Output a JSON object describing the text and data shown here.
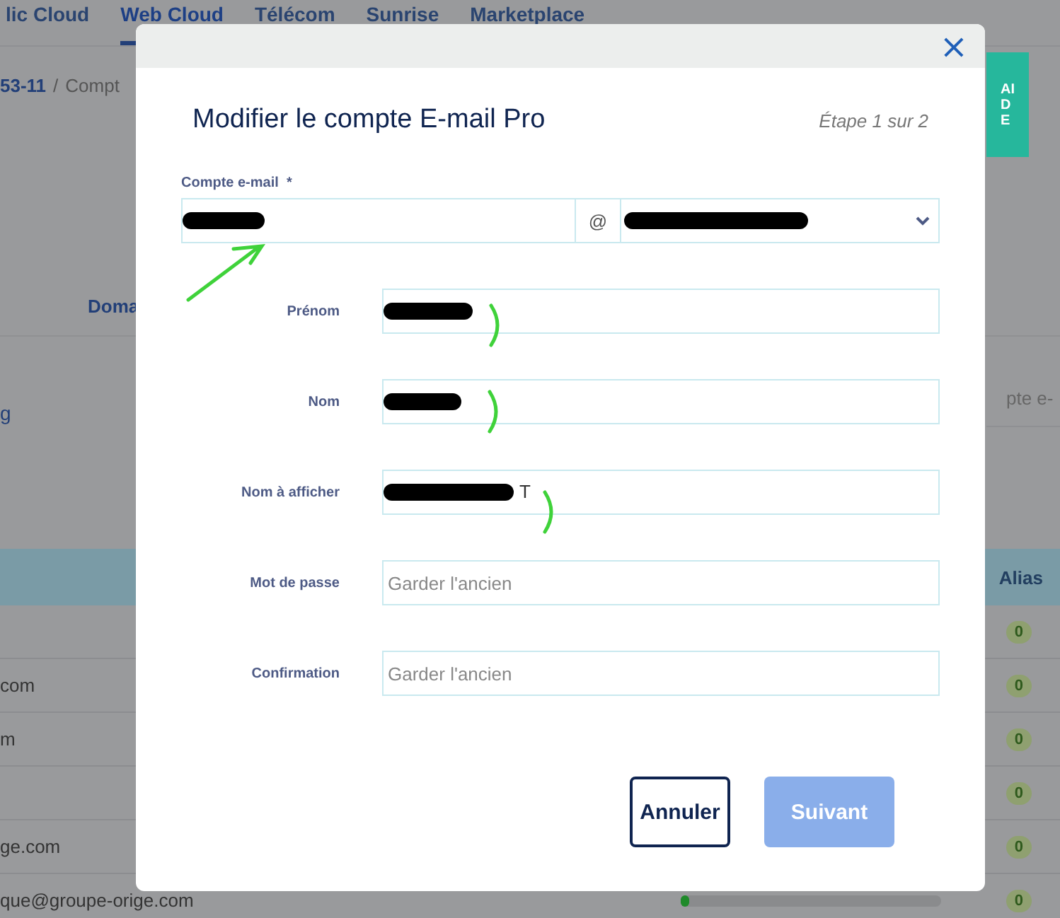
{
  "nav_tabs": [
    {
      "label": "lic Cloud",
      "selected": false
    },
    {
      "label": "Web Cloud",
      "selected": true
    },
    {
      "label": "Télécom",
      "selected": false
    },
    {
      "label": "Sunrise",
      "selected": false
    },
    {
      "label": "Marketplace",
      "selected": false
    }
  ],
  "breadcrumb": {
    "id": "53-11",
    "separator": "/",
    "current": "Compt"
  },
  "background": {
    "tab": "Doma",
    "link": "g",
    "search_placeholder": "pte e-",
    "alias_header": "Alias"
  },
  "progress": {
    "level": 0.03
  },
  "rows": [
    {
      "email": "",
      "alias": "0"
    },
    {
      "email": "com",
      "alias": "0"
    },
    {
      "email": "m",
      "alias": "0"
    },
    {
      "email": "",
      "alias": "0"
    },
    {
      "email": "ge.com",
      "alias": "0"
    },
    {
      "email": "que@groupe-orige.com",
      "alias": "0"
    }
  ],
  "help_tab": "AIDE",
  "modal": {
    "close": "×",
    "title": "Modifier le compte E-mail Pro",
    "step": "Étape 1 sur 2",
    "account": {
      "label": "Compte e-mail",
      "required": "*",
      "at": "@",
      "redacted": true
    },
    "fields": [
      {
        "label": "Prénom",
        "redacted": true
      },
      {
        "label": "Nom",
        "redacted": true
      },
      {
        "label": "Nom à afficher",
        "redacted": true,
        "value": "T"
      },
      {
        "label": "Mot de passe",
        "placeholder": "Garder l'ancien"
      },
      {
        "label": "Confirmation",
        "placeholder": "Garder l'ancien"
      }
    ],
    "buttons": [
      {
        "label": "Annuler",
        "kind": "secondary"
      },
      {
        "label": "Suivant",
        "kind": "primary",
        "disabled": true
      }
    ]
  }
}
